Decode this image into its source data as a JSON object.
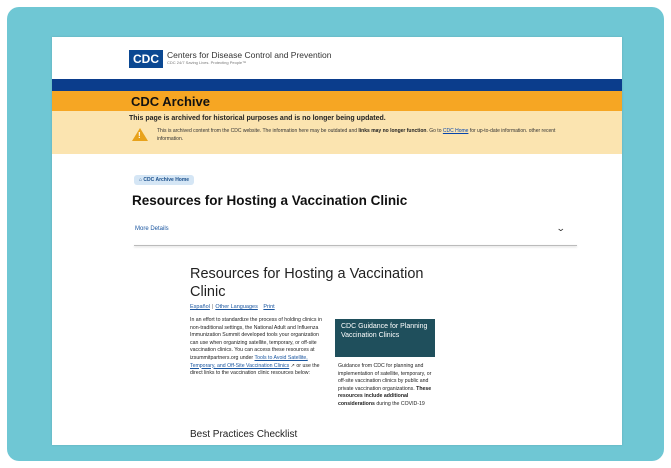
{
  "header": {
    "logo_text": "CDC",
    "org_name": "Centers for Disease Control and Prevention",
    "tagline": "CDC 24/7 Saving Lives. Protecting People™"
  },
  "archive": {
    "title": "CDC Archive",
    "notice_heading": "This page is archived for historical purposes and is no longer being updated.",
    "notice_text_1": "This is archived content from the CDC website. The information here may be outdated and ",
    "notice_bold": "links may no longer function",
    "notice_text_2": ". Go to ",
    "notice_link": "CDC Home",
    "notice_text_3": " for up-to-date information. other recent information."
  },
  "breadcrumb": {
    "label": "CDC Archive Home"
  },
  "page": {
    "title": "Resources for Hosting a Vaccination Clinic",
    "more_details": "More Details"
  },
  "document": {
    "title": "Resources for Hosting a Vaccination Clinic",
    "link_espanol": "Español",
    "link_other": "Other Languages",
    "link_print": "Print",
    "body_1": "In an effort to standardize the process of holding clinics in non-traditional settings, the National Adult and Influenza Immunization Summit developed tools your organization can use when organizing satellite, temporary, or off-site vaccination clinics. You can access these resources at izsummitpartners.org under ",
    "body_link": "Tools to Avoid Satellite, Temporary, and Off-Site Vaccination Clinics",
    "body_2": " or use the direct links to the vaccination clinic resources below:",
    "sidebar_title": "CDC Guidance for Planning Vaccination Clinics",
    "sidebar_text_1": "Guidance from CDC for planning and implementation of satellite, temporary, or off-site vaccination clinics by public and private vaccination organizations. ",
    "sidebar_bold": "These resources include additional considerations",
    "sidebar_text_2": " during the COVID-19",
    "best_practices": "Best Practices Checklist"
  },
  "colors": {
    "teal_frame": "#6fc7d4",
    "cdc_blue": "#0b4892",
    "archive_orange": "#f6a623",
    "notice_yellow": "#fbe4b0",
    "sidebar_teal": "#1f4f5c"
  }
}
